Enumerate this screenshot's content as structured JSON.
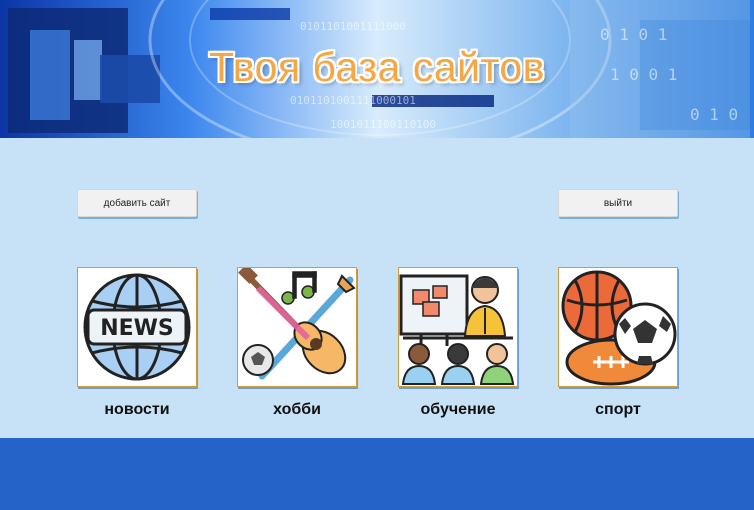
{
  "header": {
    "title": "Твоя база сайтов",
    "binary_text": "0101101001111000101011001011100110100101"
  },
  "actions": {
    "add_site_label": "добавить сайт",
    "logout_label": "выйти"
  },
  "categories": [
    {
      "label": "новости",
      "icon": "news-globe-icon",
      "icon_text": "NEWS"
    },
    {
      "label": "хобби",
      "icon": "hobby-guitar-icon"
    },
    {
      "label": "обучение",
      "icon": "teaching-class-icon"
    },
    {
      "label": "спорт",
      "icon": "sports-balls-icon"
    }
  ],
  "colors": {
    "page_background": "#c7e2f6",
    "footer": "#2563c9",
    "title_fill": "#f7a646",
    "card_border": "#d59a3c"
  }
}
